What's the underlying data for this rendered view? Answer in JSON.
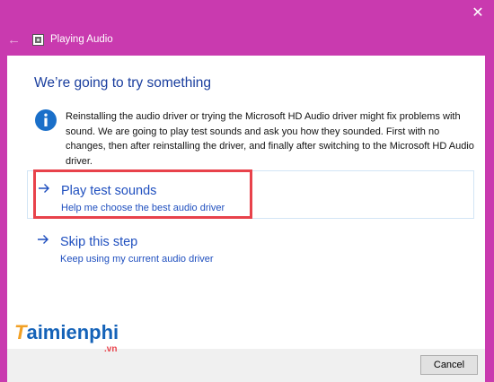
{
  "window": {
    "close_glyph": "✕",
    "back_glyph": "←",
    "app_icon": "speaker-icon",
    "title": "Playing Audio",
    "titlebar_color": "#c93aaf"
  },
  "content": {
    "heading": "We’re going to try something",
    "info_icon": "info-icon",
    "info_text": "Reinstalling the audio driver or trying the Microsoft HD Audio driver might fix problems with sound. We are going to play test sounds and ask you how they sounded. First with no changes, then after reinstalling the driver, and finally after switching to the Microsoft HD Audio driver.",
    "options": [
      {
        "title": "Play test sounds",
        "subtitle": "Help me choose the best audio driver",
        "icon": "arrow-right-icon"
      },
      {
        "title": "Skip this step",
        "subtitle": "Keep using my current audio driver",
        "icon": "arrow-right-icon"
      }
    ],
    "link_color": "#1f4fbf",
    "highlight_color": "#e8424b"
  },
  "footer": {
    "cancel_label": "Cancel"
  },
  "watermark": {
    "first_letter": "T",
    "rest": "aimienphi",
    "suffix": ".vn"
  }
}
